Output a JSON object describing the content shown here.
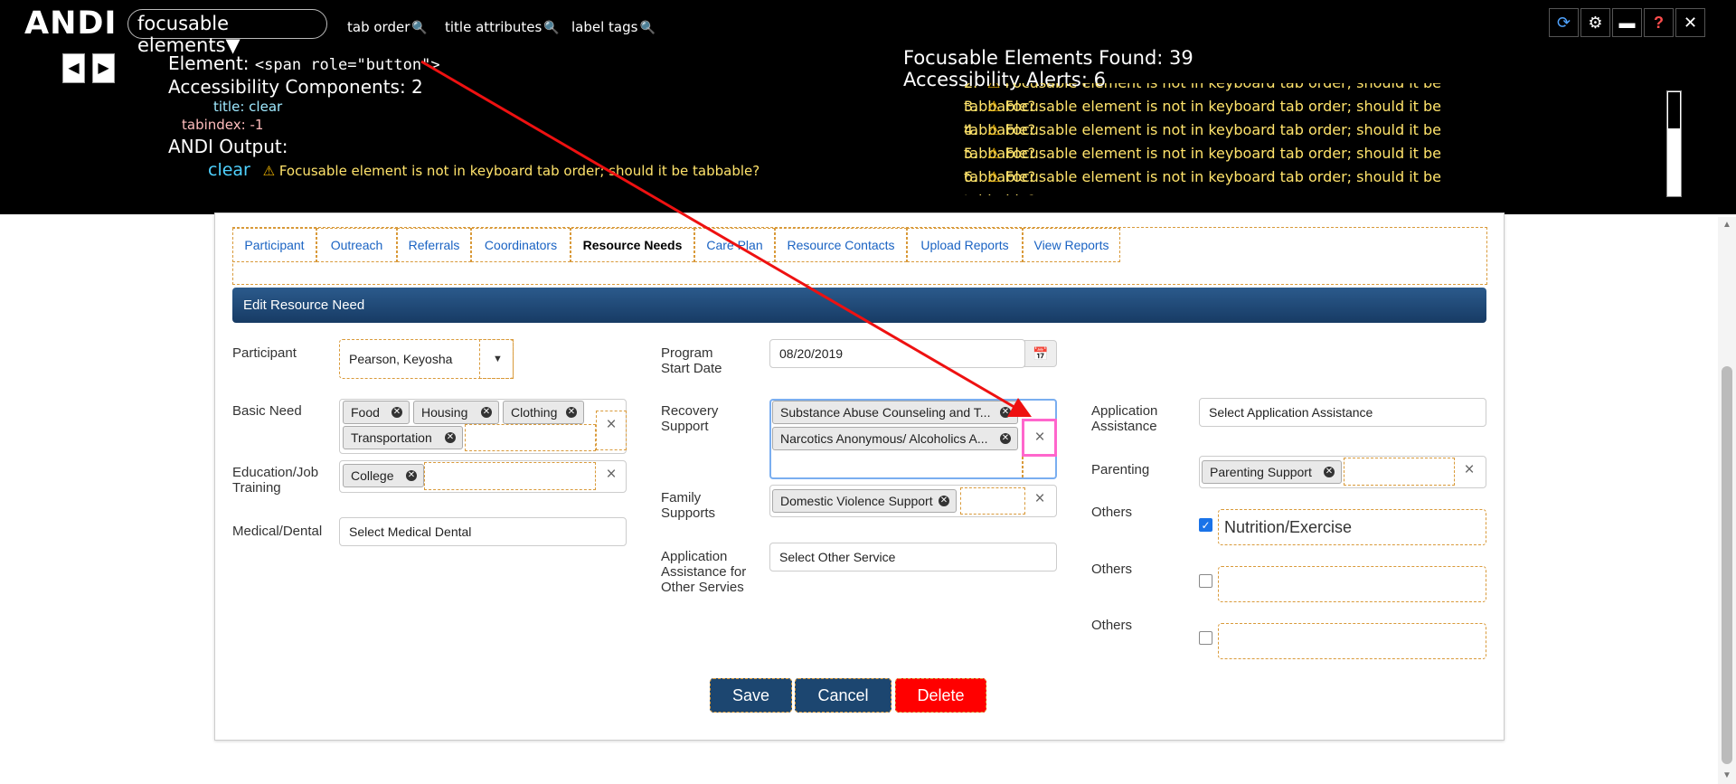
{
  "andi": {
    "logo": "ANDI",
    "module": "focusable elements▼",
    "links": [
      "tab order",
      "title attributes",
      "label tags"
    ],
    "prev": "◀",
    "next": "▶",
    "element_label": "Element:",
    "element_code": "<span role=\"button\">",
    "components": "Accessibility Components: 2",
    "props": [
      {
        "key": "title:",
        "value": "clear"
      },
      {
        "key": "tabindex:",
        "value": "-1"
      }
    ],
    "output_label": "ANDI Output:",
    "output_name": "clear",
    "output_warning": "Focusable element is not in keyboard tab order; should it be tabbable?",
    "found": "Focusable Elements Found: 39",
    "alerts_count": "Accessibility Alerts: 6",
    "alerts": [
      {
        "n": "2.",
        "text": "Focusable element is not in keyboard tab order; should it be tabbable?"
      },
      {
        "n": "3.",
        "text": "Focusable element is not in keyboard tab order; should it be tabbable?"
      },
      {
        "n": "4.",
        "text": "Focusable element is not in keyboard tab order; should it be tabbable?"
      },
      {
        "n": "5.",
        "text": "Focusable element is not in keyboard tab order; should it be tabbable?"
      },
      {
        "n": "6.",
        "text": "Focusable element is not in keyboard tab order; should it be tabbable?"
      }
    ],
    "warn_icon": "⚠",
    "controls": [
      "refresh-icon",
      "gear-icon",
      "keyboard-icon",
      "help-icon",
      "close-icon"
    ]
  },
  "tabs": [
    "Participant",
    "Outreach",
    "Referrals",
    "Coordinators",
    "Resource Needs",
    "Care Plan",
    "Resource Contacts",
    "Upload Reports",
    "View Reports"
  ],
  "section_title": "Edit Resource Need",
  "form": {
    "participant_label": "Participant",
    "participant_value": "Pearson, Keyosha",
    "basic_need_label": "Basic Need",
    "basic_need_chips": [
      "Food",
      "Housing",
      "Clothing",
      "Transportation"
    ],
    "education_label": "Education/Job Training",
    "education_chips": [
      "College"
    ],
    "medical_label": "Medical/Dental",
    "medical_placeholder": "Select Medical Dental",
    "program_start_label": "Program Start Date",
    "program_start_value": "08/20/2019",
    "recovery_label": "Recovery Support",
    "recovery_chips": [
      "Substance Abuse Counseling and T...",
      "Narcotics Anonymous/ Alcoholics A..."
    ],
    "family_label": "Family Supports",
    "family_chips": [
      "Domestic Violence Support"
    ],
    "app_other_label": "Application Assistance for Other Servies",
    "app_other_placeholder": "Select Other Service",
    "app_assist_label": "Application Assistance",
    "app_assist_placeholder": "Select Application Assistance",
    "parenting_label": "Parenting",
    "parenting_chips": [
      "Parenting Support"
    ],
    "others_label": "Others",
    "others_1_value": "Nutrition/Exercise",
    "others_2_value": "",
    "others_3_value": ""
  },
  "buttons": {
    "save": "Save",
    "cancel": "Cancel",
    "delete": "Delete"
  }
}
